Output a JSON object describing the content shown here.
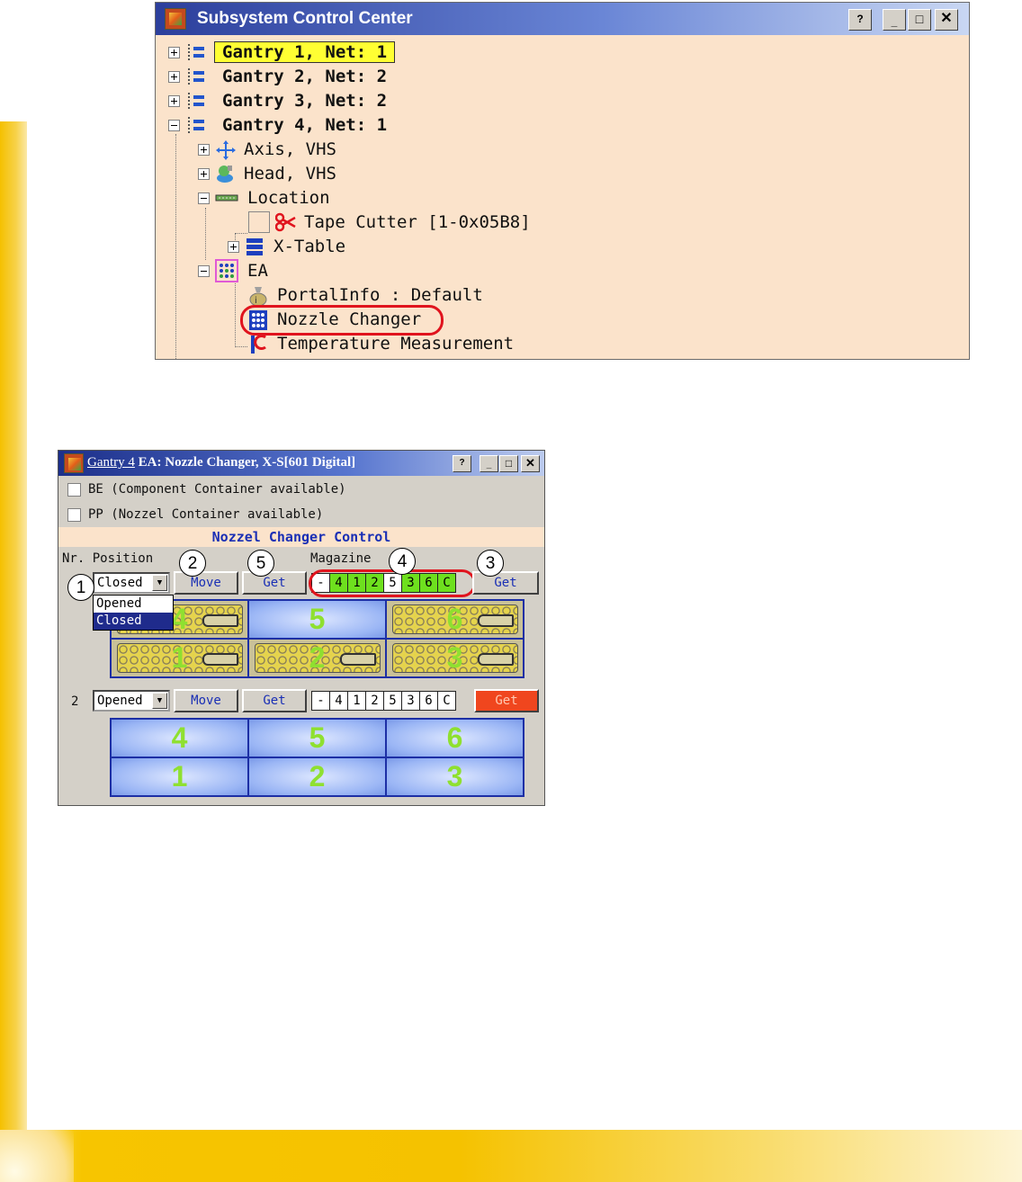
{
  "window_main": {
    "title": "Subsystem Control Center",
    "tree": [
      {
        "label": "Gantry 1, Net:  1",
        "level": 0,
        "state": "collapsed",
        "highlighted": true
      },
      {
        "label": "Gantry 2, Net:  2",
        "level": 0,
        "state": "collapsed"
      },
      {
        "label": "Gantry 3, Net:  2",
        "level": 0,
        "state": "collapsed"
      },
      {
        "label": "Gantry 4, Net:  1",
        "level": 0,
        "state": "expanded"
      },
      {
        "label": "Axis, VHS",
        "level": 1,
        "state": "collapsed"
      },
      {
        "label": "Head, VHS",
        "level": 1,
        "state": "collapsed"
      },
      {
        "label": "Location",
        "level": 1,
        "state": "expanded"
      },
      {
        "label": "Tape Cutter [1-0x05B8]",
        "level": 2,
        "state": "leaf"
      },
      {
        "label": "X-Table",
        "level": 2,
        "state": "collapsed"
      },
      {
        "label": "EA",
        "level": 1,
        "state": "expanded"
      },
      {
        "label": "PortalInfo : Default",
        "level": 2,
        "state": "leaf"
      },
      {
        "label": "Nozzle Changer",
        "level": 2,
        "state": "leaf",
        "circled": true
      },
      {
        "label": "Temperature Measurement",
        "level": 2,
        "state": "leaf"
      }
    ]
  },
  "window_nozzle": {
    "title_link": "Gantry 4",
    "title_rest": " EA: Nozzle Changer, X-S[601 Digital]",
    "checkbox_be": "BE (Component Container available)",
    "checkbox_pp": "PP (Nozzel Container available)",
    "control_header": "Nozzel Changer Control",
    "col_nr_position": "Nr. Position",
    "col_magazine": "Magazine",
    "row1": {
      "position_value": "Closed",
      "move_label": "Move",
      "get_label": "Get",
      "magazine_cells": [
        "-",
        "4",
        "1",
        "2",
        "5",
        "3",
        "6",
        "C"
      ],
      "get2_label": "Get",
      "dropdown_options": [
        "Opened",
        "Closed"
      ],
      "dropdown_selected": "Closed",
      "slots_top": [
        "4",
        "5",
        "6"
      ],
      "slots_bottom": [
        "1",
        "2",
        "3"
      ]
    },
    "row2": {
      "nr": "2",
      "position_value": "Opened",
      "move_label": "Move",
      "get_label": "Get",
      "magazine_cells": [
        "-",
        "4",
        "1",
        "2",
        "5",
        "3",
        "6",
        "C"
      ],
      "get2_label": "Get",
      "slots_top": [
        "4",
        "5",
        "6"
      ],
      "slots_bottom": [
        "1",
        "2",
        "3"
      ]
    }
  },
  "callouts": [
    "1",
    "2",
    "3",
    "4",
    "5"
  ],
  "colors": {
    "accent_yellow": "#f5c200",
    "tree_background": "#fbe3cb",
    "highlight": "#ffff33",
    "callout_red": "#e0141e",
    "slot_number_green": "#8fe030",
    "grid_border": "#1d2fa5",
    "get_red": "#f0461e"
  }
}
